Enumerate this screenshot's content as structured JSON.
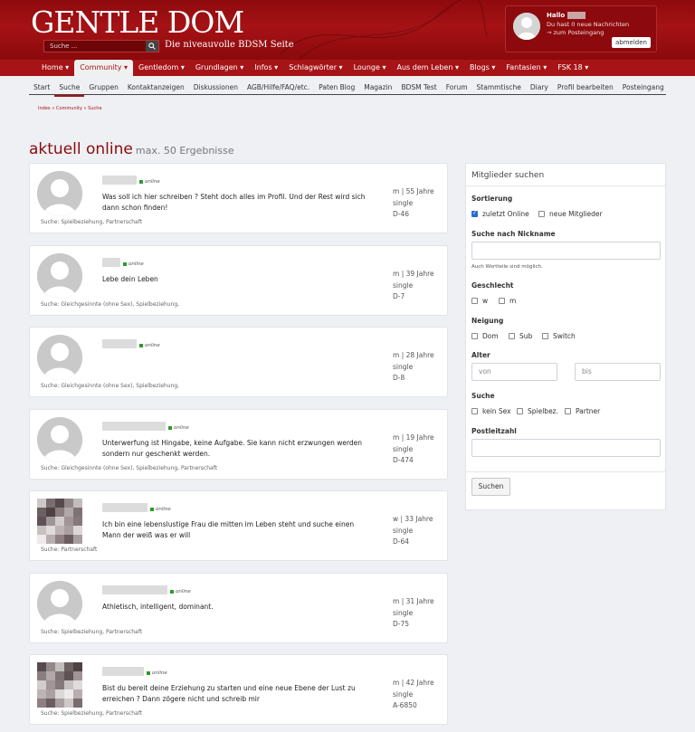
{
  "header": {
    "logo": "GENTLE DOM",
    "tagline": "Die niveauvolle BDSM Seite",
    "search_placeholder": "Suche ...",
    "user": {
      "greeting": "Hallo",
      "messages": "Du hast 0 neue Nachrichten",
      "inbox_link": "→ zum Posteingang",
      "logout": "abmelden"
    }
  },
  "mainnav": [
    "Home ▾",
    "Community ▾",
    "Gentledom ▾",
    "Grundlagen ▾",
    "Infos ▾",
    "Schlagwörter ▾",
    "Lounge ▾",
    "Aus dem Leben ▾",
    "Blogs ▾",
    "Fantasien ▾",
    "FSK 18 ▾"
  ],
  "mainnav_active": 1,
  "subnav": [
    "Start",
    "Suche",
    "Gruppen",
    "Kontaktanzeigen",
    "Diskussionen",
    "AGB/Hilfe/FAQ/etc.",
    "Paten Blog",
    "Magazin",
    "BDSM Test",
    "Forum",
    "Stammtische",
    "Diary",
    "Profil bearbeiten",
    "Posteingang"
  ],
  "subnav_active": 1,
  "breadcrumb": "Index » Community » Suche",
  "page": {
    "title": "aktuell online",
    "subtitle": "max. 50 Ergebnisse"
  },
  "results": [
    {
      "online": "online",
      "text": "Was soll ich hier schreiben ? Steht doch alles im Profil. Und der Rest wird sich dann schon finden!",
      "gender_age": "m | 55 Jahre",
      "status": "single",
      "region": "D-46",
      "seek": "Suche: Spielbeziehung, Partnerschaft"
    },
    {
      "online": "online",
      "text": "Lebe dein Leben",
      "gender_age": "m | 39 Jahre",
      "status": "single",
      "region": "D-7",
      "seek": "Suche: Gleichgesinnte (ohne Sex), Spielbeziehung,"
    },
    {
      "online": "online",
      "text": "",
      "gender_age": "m | 28 Jahre",
      "status": "single",
      "region": "D-8",
      "seek": "Suche: Gleichgesinnte (ohne Sex), Spielbeziehung,"
    },
    {
      "online": "online",
      "text": "Unterwerfung ist Hingabe, keine Aufgabe. Sie kann nicht erzwungen werden sondern nur geschenkt werden.",
      "gender_age": "m | 19 Jahre",
      "status": "single",
      "region": "D-474",
      "seek": "Suche: Gleichgesinnte (ohne Sex), Spielbeziehung, Partnerschaft"
    },
    {
      "online": "online",
      "text": "Ich bin eine lebenslustige Frau die mitten im Leben steht und suche einen Mann der weiß was er will",
      "gender_age": "w | 33 Jahre",
      "status": "single",
      "region": "D-64",
      "seek": "Suche: Partnerschaft"
    },
    {
      "online": "online",
      "text": "Athletisch, intelligent, dominant.",
      "gender_age": "m | 31 Jahre",
      "status": "single",
      "region": "D-75",
      "seek": "Suche: Spielbeziehung, Partnerschaft"
    },
    {
      "online": "online",
      "text": "Bist du bereit deine Erziehung zu starten und eine neue Ebene der Lust zu erreichen ? Dann zögere nicht und schreib mir",
      "gender_age": "m | 42 Jahre",
      "status": "single",
      "region": "A-6850",
      "seek": "Suche: Spielbeziehung, Partnerschaft"
    }
  ],
  "panel": {
    "title": "Mitglieder suchen",
    "sort_label": "Sortierung",
    "sort_options": [
      "zuletzt Online",
      "neue Mitglieder"
    ],
    "sort_selected": "zuletzt Online",
    "nick_label": "Suche nach Nickname",
    "nick_value": "",
    "nick_hint": "Auch Wortteile sind möglich.",
    "gender_label": "Geschlecht",
    "gender_options": [
      "w",
      "m"
    ],
    "tendency_label": "Neigung",
    "tendency_options": [
      "Dom",
      "Sub",
      "Switch"
    ],
    "age_label": "Alter",
    "age_from_placeholder": "von",
    "age_to_placeholder": "bis",
    "seek_label": "Suche",
    "seek_options": [
      "kein Sex",
      "Spielbez.",
      "Partner"
    ],
    "zip_label": "Postleitzahl",
    "zip_value": "",
    "submit": "Suchen"
  }
}
